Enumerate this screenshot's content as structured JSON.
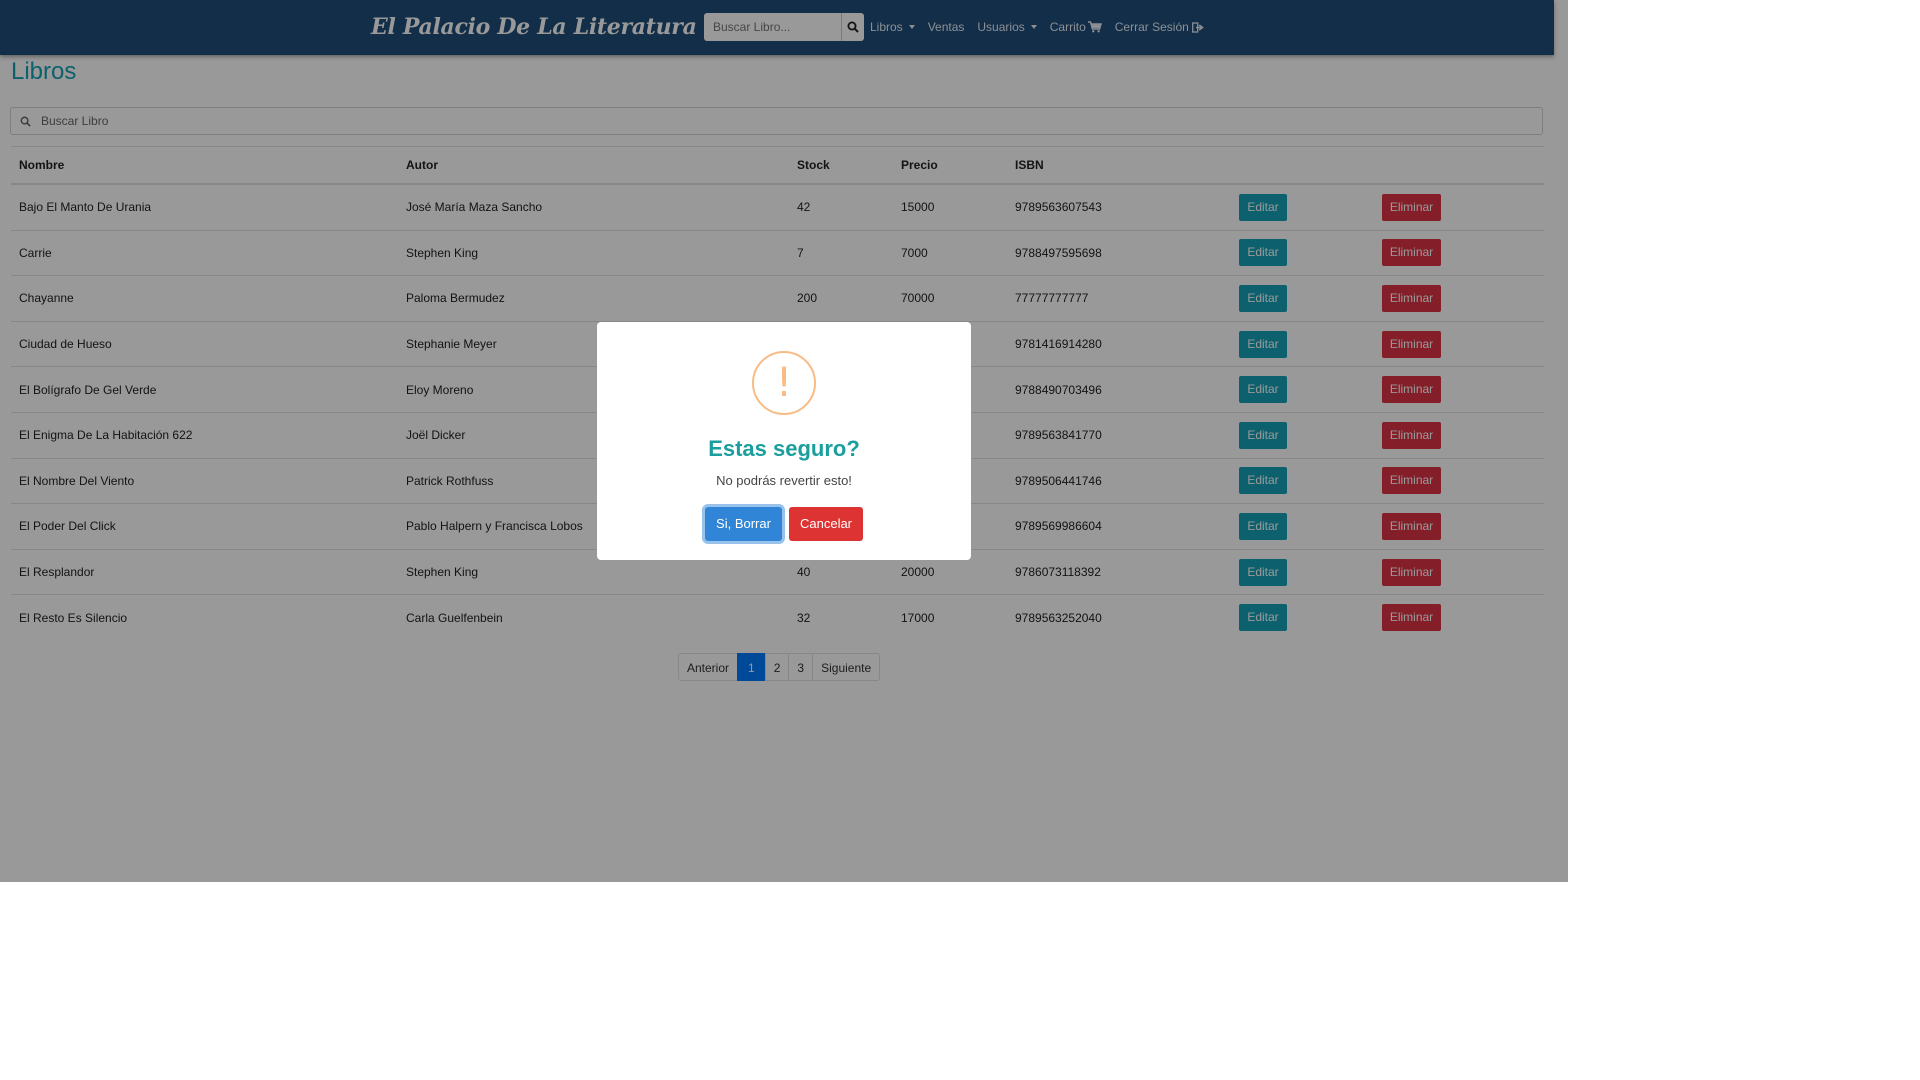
{
  "navbar": {
    "brand": "El Palacio De La Literatura",
    "search_placeholder": "Buscar Libro...",
    "links": {
      "libros": "Libros",
      "ventas": "Ventas",
      "usuarios": "Usuarios",
      "carrito": "Carrito",
      "cerrar_sesion": "Cerrar Sesión"
    }
  },
  "page": {
    "title": "Libros",
    "filter_placeholder": "Buscar Libro"
  },
  "table": {
    "headers": {
      "nombre": "Nombre",
      "autor": "Autor",
      "stock": "Stock",
      "precio": "Precio",
      "isbn": "ISBN"
    },
    "edit_label": "Editar",
    "delete_label": "Eliminar",
    "rows": [
      {
        "nombre": "Bajo El Manto De Urania",
        "autor": "José María Maza Sancho",
        "stock": "42",
        "precio": "15000",
        "isbn": "9789563607543"
      },
      {
        "nombre": "Carrie",
        "autor": "Stephen King",
        "stock": "7",
        "precio": "7000",
        "isbn": "9788497595698"
      },
      {
        "nombre": "Chayanne",
        "autor": "Paloma Bermudez",
        "stock": "200",
        "precio": "70000",
        "isbn": "77777777777"
      },
      {
        "nombre": "Ciudad de Hueso",
        "autor": "Stephanie Meyer",
        "stock": "",
        "precio": "",
        "isbn": "9781416914280"
      },
      {
        "nombre": "El Bolígrafo De Gel Verde",
        "autor": "Eloy Moreno",
        "stock": "",
        "precio": "",
        "isbn": "9788490703496"
      },
      {
        "nombre": "El Enigma De La Habitación 622",
        "autor": "Joël Dicker",
        "stock": "",
        "precio": "",
        "isbn": "9789563841770"
      },
      {
        "nombre": "El Nombre Del Viento",
        "autor": "Patrick Rothfuss",
        "stock": "",
        "precio": "",
        "isbn": "9789506441746"
      },
      {
        "nombre": "El Poder Del Click",
        "autor": "Pablo Halpern y Francisca Lobos",
        "stock": "",
        "precio": "",
        "isbn": "9789569986604"
      },
      {
        "nombre": "El Resplandor",
        "autor": "Stephen King",
        "stock": "40",
        "precio": "20000",
        "isbn": "9786073118392"
      },
      {
        "nombre": "El Resto Es Silencio",
        "autor": "Carla Guelfenbein",
        "stock": "32",
        "precio": "17000",
        "isbn": "9789563252040"
      }
    ]
  },
  "pagination": {
    "prev": "Anterior",
    "pages": [
      "1",
      "2",
      "3"
    ],
    "active_page": "1",
    "next": "Siguiente"
  },
  "modal": {
    "icon": "!",
    "title": "Estas seguro?",
    "text": "No podrás revertir esto!",
    "confirm_label": "Si, Borrar",
    "cancel_label": "Cancelar"
  },
  "colors": {
    "navbar": "#1f4e7a",
    "title_accent": "#17a2b8",
    "edit_button": "#17a2b8",
    "delete_button": "#dc3545",
    "confirm_button": "#3085d6",
    "cancel_button": "#dd3333",
    "warning_icon": "#f8bb86",
    "active_page": "#007bff"
  }
}
